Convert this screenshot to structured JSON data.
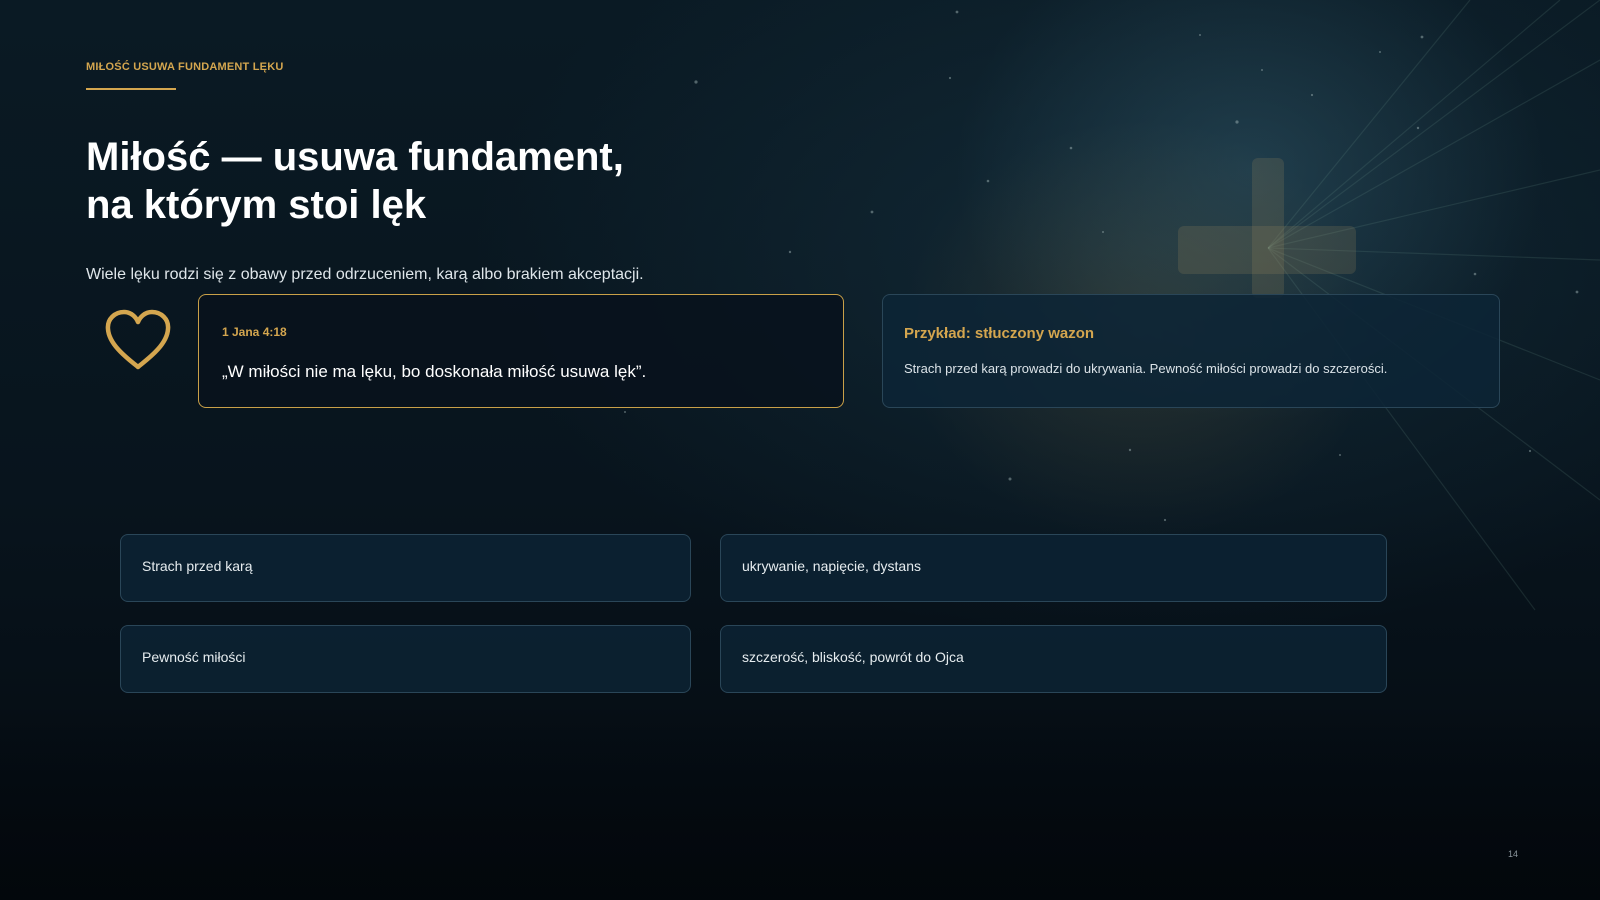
{
  "eyebrow": "MIŁOŚĆ USUWA FUNDAMENT LĘKU",
  "title": {
    "line1": "Miłość — usuwa fundament,",
    "line2": "na którym stoi lęk"
  },
  "subtitle": "Wiele lęku rodzi się z obawy przed odrzuceniem, karą albo brakiem akceptacji.",
  "quote": {
    "reference": "1 Jana 4:18",
    "text": "„W miłości nie ma lęku, bo doskonała miłość usuwa lęk”."
  },
  "example": {
    "title": "Przykład: stłuczony wazon",
    "text": "Strach przed karą prowadzi do ukrywania. Pewność miłości prowadzi do szczerości."
  },
  "rows": [
    {
      "cause": "Strach przed karą",
      "effect": "ukrywanie, napięcie, dystans"
    },
    {
      "cause": "Pewność miłości",
      "effect": "szczerość, bliskość, powrót do Ojca"
    }
  ],
  "page_number": "14",
  "icons": {
    "heart": "heart-icon",
    "cross": "cross-icon"
  },
  "colors": {
    "accent_gold": "#d4a64f",
    "background": "#08141d",
    "card": "#0c2436",
    "card_border": "#2a4658",
    "text": "#ffffff"
  }
}
